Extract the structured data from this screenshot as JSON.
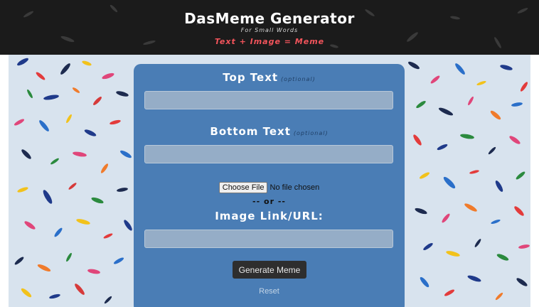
{
  "header": {
    "title": "DasMeme Generator",
    "subtitle": "For Small Words",
    "tagline": "Text + Image = Meme"
  },
  "form": {
    "top_text": {
      "label": "Top Text",
      "optional": "(optional)",
      "value": ""
    },
    "bottom_text": {
      "label": "Bottom Text",
      "optional": "(optional)",
      "value": ""
    },
    "file": {
      "button_label": "Choose File",
      "status": "No file chosen"
    },
    "or_separator": "-- or --",
    "image_url": {
      "label": "Image Link/URL:",
      "value": ""
    },
    "generate_label": "Generate Meme",
    "reset_label": "Reset"
  },
  "colors": {
    "header_bg": "#1b1b1b",
    "tagline": "#f2545b",
    "panel_bg": "#4a7db5",
    "input_bg": "#95adc7",
    "button_bg": "#2e2e2e"
  }
}
